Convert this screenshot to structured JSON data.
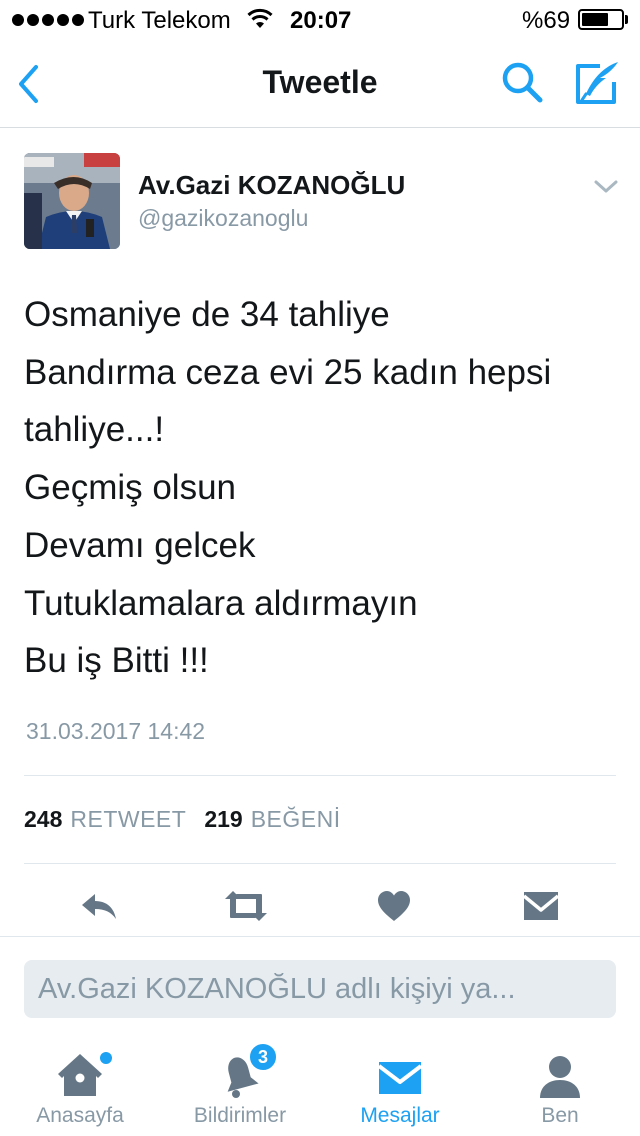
{
  "status_bar": {
    "carrier": "Turk Telekom",
    "time": "20:07",
    "battery_percent_text": "%69",
    "battery_level": 0.69,
    "signal_bars": 5
  },
  "nav": {
    "title": "Tweetle",
    "back_icon": "chevron-left-icon",
    "search_icon": "search-icon",
    "compose_icon": "compose-icon"
  },
  "tweet": {
    "author_name": "Av.Gazi KOZANOĞLU",
    "author_handle": "@gazikozanoglu",
    "text_lines": [
      "Osmaniye de 34 tahliye",
      "Bandırma ceza evi 25 kadın hepsi",
      "tahliye...!",
      "Geçmiş olsun",
      "Devamı gelcek",
      "Tutuklamalara aldırmayın",
      "Bu iş Bitti !!!"
    ],
    "timestamp": "31.03.2017 14:42",
    "retweet_count": "248",
    "retweet_label": "RETWEET",
    "like_count": "219",
    "like_label": "BEĞENİ"
  },
  "actions": [
    "reply-icon",
    "retweet-icon",
    "heart-icon",
    "message-icon"
  ],
  "reply": {
    "placeholder": "Av.Gazi KOZANOĞLU adlı kişiyi ya..."
  },
  "tabs": [
    {
      "label": "Anasayfa",
      "icon": "home-icon",
      "active": false
    },
    {
      "label": "Bildirimler",
      "icon": "bell-icon",
      "active": false,
      "badge": "3"
    },
    {
      "label": "Mesajlar",
      "icon": "envelope-icon",
      "active": true
    },
    {
      "label": "Ben",
      "icon": "person-icon",
      "active": false
    }
  ],
  "colors": {
    "accent": "#1da1f2",
    "icon_gray": "#657786",
    "text_secondary": "#8899a6"
  }
}
